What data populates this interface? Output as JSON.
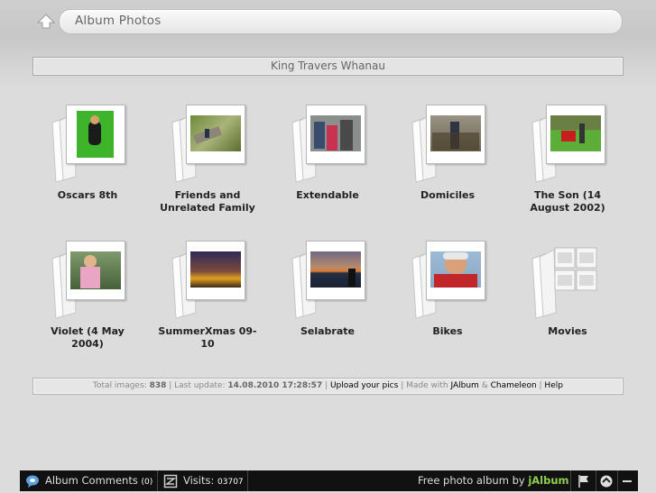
{
  "header": {
    "up_icon": "up-arrow-icon",
    "title": "Album Photos",
    "subtitle": "King Travers Whanau"
  },
  "albums": [
    {
      "label_line1": "Oscars 8th",
      "label_line2": "",
      "thumb": "green"
    },
    {
      "label_line1": "Friends and",
      "label_line2": "Unrelated Family",
      "thumb": "path"
    },
    {
      "label_line1": "Extendable",
      "label_line2": "",
      "thumb": "people"
    },
    {
      "label_line1": "Domiciles",
      "label_line2": "",
      "thumb": "woods"
    },
    {
      "label_line1": "The Son (14",
      "label_line2": "August 2002)",
      "thumb": "mower"
    },
    {
      "label_line1": "Violet (4 May",
      "label_line2": "2004)",
      "thumb": "girl"
    },
    {
      "label_line1": "SummerXmas 09-",
      "label_line2": "10",
      "thumb": "sunset"
    },
    {
      "label_line1": "Selabrate",
      "label_line2": "",
      "thumb": "sea"
    },
    {
      "label_line1": "Bikes",
      "label_line2": "",
      "thumb": "cyclist"
    },
    {
      "label_line1": "Movies",
      "label_line2": "",
      "thumb": "empty"
    }
  ],
  "footer": {
    "total_label": "Total images:",
    "total_value": "838",
    "update_label": "Last update:",
    "update_value": "14.08.2010 17:28:57",
    "upload_link": "Upload your pics",
    "made_with": "Made with",
    "jalbum_link": "JAlbum",
    "amp": "&",
    "chameleon_link": "Chameleon",
    "help_link": "Help"
  },
  "bottombar": {
    "comments_label": "Album Comments",
    "comments_count": "(0)",
    "visits_label": "Visits:",
    "visits_count": "03707",
    "free_label": "Free photo album by",
    "brand": "jAlbum",
    "icons": [
      "speech-bubble-icon",
      "counter-icon",
      "flag-icon",
      "share-icon",
      "minimize-icon"
    ]
  },
  "colors": {
    "brand_green": "#8fcf4f",
    "bar_bg": "#111111",
    "page_bg": "#dcdcdc"
  }
}
